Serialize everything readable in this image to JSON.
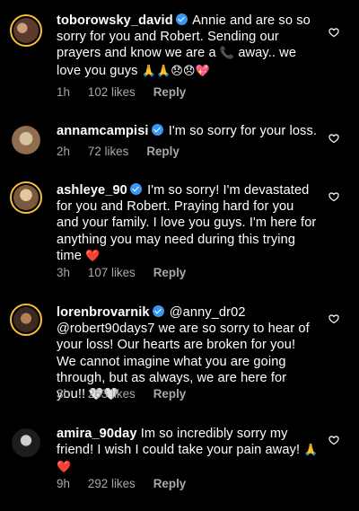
{
  "comments": [
    {
      "username": "toborowsky_david",
      "verified": true,
      "text": "Annie and are so so sorry for you and Robert. Sending our prayers and know we are a ",
      "emoji_phone": "📞",
      "text2": " away.. we love you guys ",
      "emoji_tail": "🙏🙏😞😞💖",
      "time": "1h",
      "likes": "102 likes",
      "reply": "Reply",
      "avatar_colors": [
        "#5a3b2c",
        "#c9a27a"
      ]
    },
    {
      "username": "annamcampisi",
      "verified": true,
      "text": "I'm so sorry for your loss.",
      "time": "2h",
      "likes": "72 likes",
      "reply": "Reply",
      "avatar_colors": [
        "#d8c3a0",
        "#8f6d4e"
      ]
    },
    {
      "username": "ashleye_90",
      "verified": true,
      "text": "I'm so sorry! I'm devastated for you and Robert. Praying hard for you and your family. I love you guys. I'm here for anything you may need during this trying time ",
      "emoji_tail": "❤️",
      "time": "3h",
      "likes": "107 likes",
      "reply": "Reply",
      "avatar_colors": [
        "#e2c79d",
        "#7a5a3e"
      ]
    },
    {
      "username": "lorenbrovarnik",
      "verified": true,
      "text": "@anny_dr02 @robert90days7 we are so sorry to hear of your loss! Our hearts are broken for you! We cannot imagine what you are going through, but as always, we are here for you!! ",
      "emoji_tail": "🤍🤍",
      "time": "3h",
      "likes": "263 likes",
      "reply": "Reply",
      "avatar_colors": [
        "#3b2a22",
        "#b6805c"
      ]
    },
    {
      "username": "amira_90day",
      "verified": false,
      "text": "Im so incredibly sorry my friend! I wish I could take your pain away! ",
      "emoji_tail": "🙏❤️",
      "time": "9h",
      "likes": "292 likes",
      "reply": "Reply",
      "avatar_colors": [
        "#1d1d1d",
        "#cfcfcf"
      ]
    }
  ],
  "icons": {
    "like": "heart-outline-icon",
    "verified": "verified-badge-icon"
  },
  "colors": {
    "background": "#000000",
    "text": "#ffffff",
    "meta": "#a8a8a8",
    "verified": "#3897f0",
    "story_ring": "#fbc02d"
  }
}
